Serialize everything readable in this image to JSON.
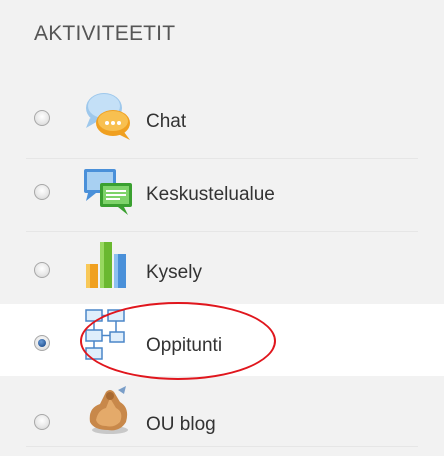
{
  "section": {
    "title": "AKTIVITEETIT"
  },
  "activities": [
    {
      "label": "Chat",
      "icon": "chat-icon",
      "selected": false
    },
    {
      "label": "Keskustelualue",
      "icon": "forum-icon",
      "selected": false
    },
    {
      "label": "Kysely",
      "icon": "chart-icon",
      "selected": false
    },
    {
      "label": "Oppitunti",
      "icon": "lesson-flowchart-icon",
      "selected": true
    },
    {
      "label": "OU blog",
      "icon": "blog-icon",
      "selected": false
    }
  ],
  "colors": {
    "background": "#f2f2f2",
    "selected_row": "#ffffff",
    "annotation_circle": "#e0161d",
    "radio_checked": "#2a5a9a"
  }
}
